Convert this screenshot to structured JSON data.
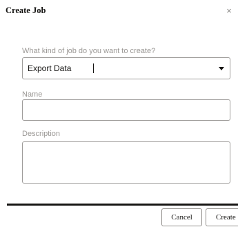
{
  "dialog": {
    "title": "Create Job",
    "close_glyph": "×",
    "close_icon": "close-icon"
  },
  "form": {
    "job_kind": {
      "label": "What kind of job do you want to create?",
      "selected_value": "Export Data",
      "dropdown_icon": "chevron-down-icon"
    },
    "name": {
      "label": "Name",
      "value": ""
    },
    "description": {
      "label": "Description",
      "value": ""
    }
  },
  "footer": {
    "cancel_label": "Cancel",
    "create_label": "Create"
  },
  "colors": {
    "text": "#161513",
    "label": "#9b9895",
    "border": "#9e9c9a",
    "footer_bar": "#161513"
  }
}
